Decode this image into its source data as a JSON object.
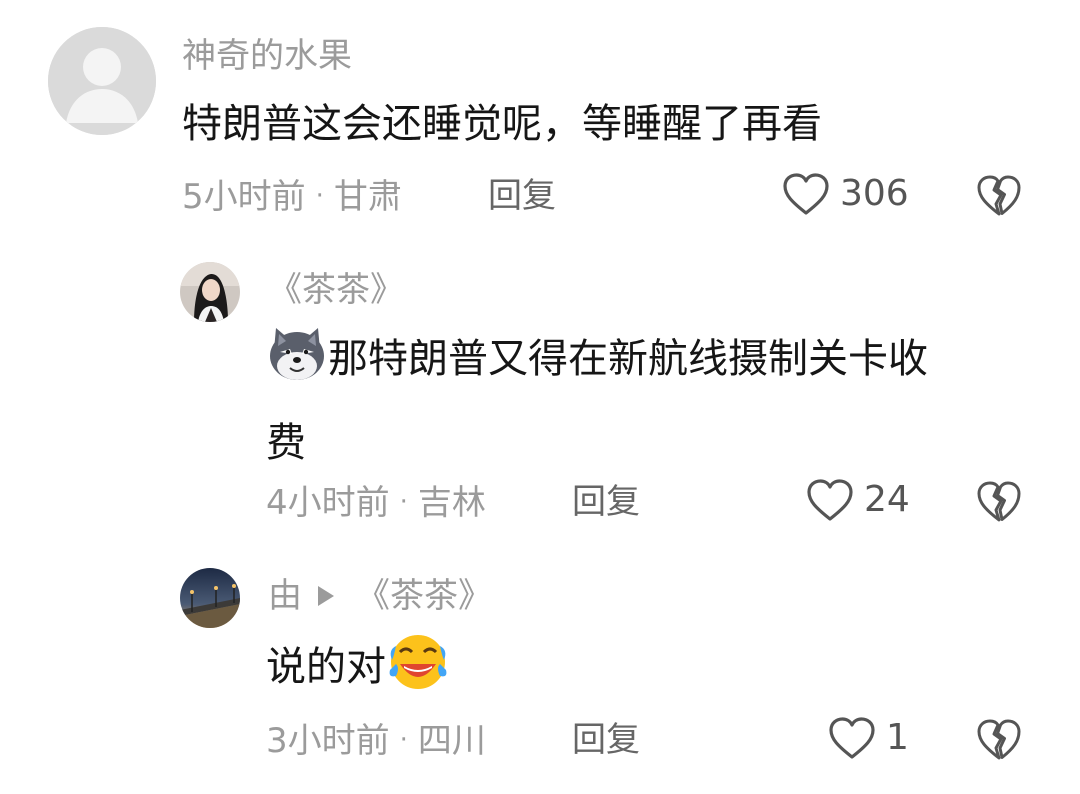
{
  "comments": [
    {
      "author": "神奇的水果",
      "text": "特朗普这会还睡觉呢，等睡醒了再看",
      "time": "5小时前",
      "location": "甘肃",
      "reply_label": "回复",
      "likes": "306",
      "avatar": "default-avatar"
    },
    {
      "author": "《茶茶》",
      "emoji": "wolf-emoji",
      "text_line1": "那特朗普又得在新航线摄制关卡收",
      "text_line2": "费",
      "time": "4小时前",
      "location": "吉林",
      "reply_label": "回复",
      "likes": "24",
      "avatar": "girl-photo-avatar"
    },
    {
      "author": "由",
      "reply_to": "《茶茶》",
      "text": "说的对",
      "emoji": "laughing-crying-emoji",
      "time": "3小时前",
      "location": "四川",
      "reply_label": "回复",
      "likes": "1",
      "avatar": "city-night-avatar"
    }
  ],
  "separator": "·",
  "icons": {
    "like": "heart-outline-icon",
    "dislike": "broken-heart-icon"
  },
  "colors": {
    "text_primary": "#161616",
    "text_secondary": "#9b9b9b",
    "icon": "#555555"
  }
}
